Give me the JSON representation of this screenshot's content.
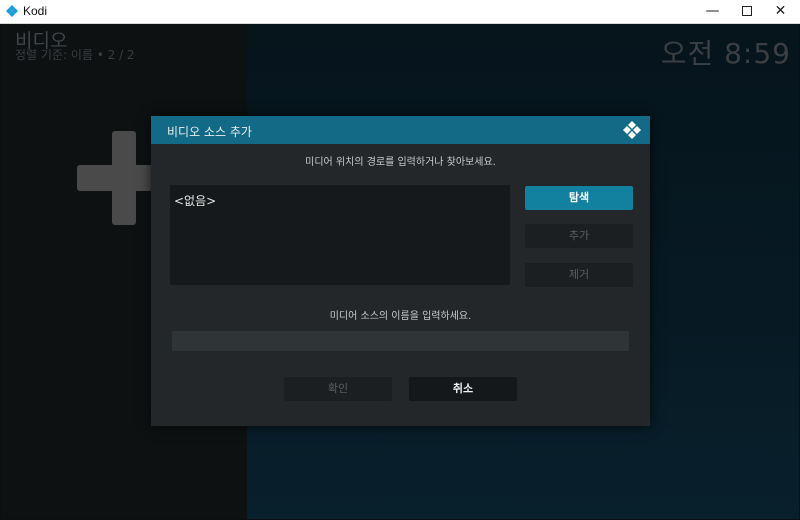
{
  "window": {
    "title": "Kodi",
    "minimize": "—",
    "close": "✕"
  },
  "header": {
    "title": "비디오",
    "subtitle": "정렬 기준: 이름  •  2 / 2",
    "clock": "오전 8:59"
  },
  "dialog": {
    "title": "비디오 소스 추가",
    "path_prompt": "미디어 위치의 경로를 입력하거나 찾아보세요.",
    "paths": [
      "<없음>"
    ],
    "browse_label": "탐색",
    "add_label": "추가",
    "remove_label": "제거",
    "name_prompt": "미디어 소스의 이름을 입력하세요.",
    "name_value": "",
    "ok_label": "확인",
    "cancel_label": "취소"
  },
  "colors": {
    "accent": "#12809f",
    "header_bar": "#136a86",
    "dialog_bg": "#232729"
  },
  "icons": {
    "app_logo": "kodi-logo-icon",
    "add_source": "plus-icon"
  }
}
